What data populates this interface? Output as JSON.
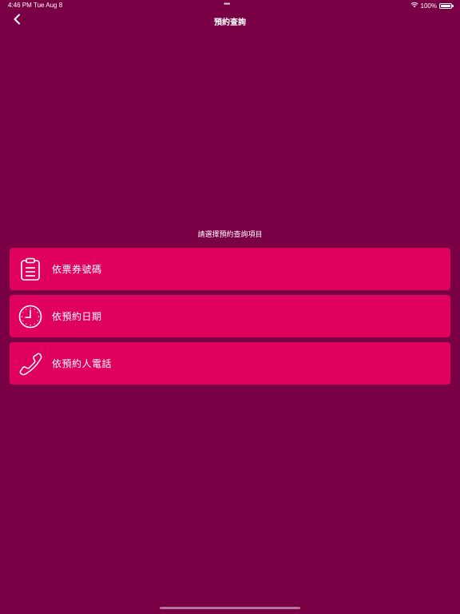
{
  "status_bar": {
    "time": "4:46 PM",
    "date": "Tue Aug 8",
    "battery": "100%"
  },
  "nav": {
    "title": "預約查詢",
    "back_icon": "chevron-left-icon"
  },
  "prompt": "請選擇預約查詢項目",
  "options": [
    {
      "label": "依票券號碼",
      "icon": "clipboard-icon"
    },
    {
      "label": "依預約日期",
      "icon": "clock-icon"
    },
    {
      "label": "依預約人電話",
      "icon": "phone-icon"
    }
  ],
  "colors": {
    "background": "#7a0045",
    "button": "#e0005e",
    "text": "#ffffff"
  }
}
